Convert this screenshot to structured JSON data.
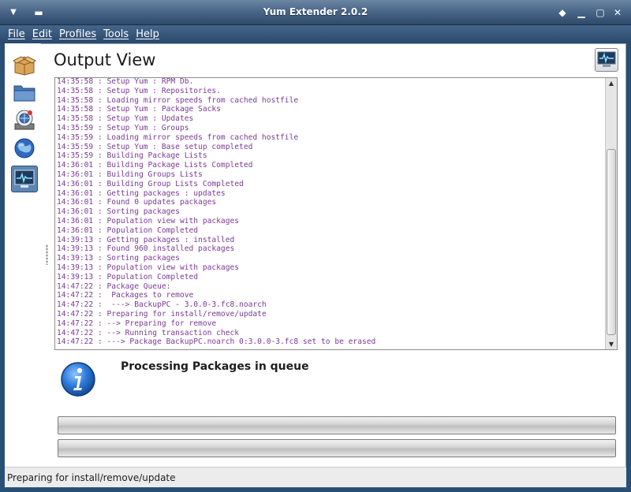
{
  "window": {
    "title": "Yum Extender 2.0.2"
  },
  "menu": [
    "File",
    "Edit",
    "Profiles",
    "Tools",
    "Help"
  ],
  "sidebar": {
    "items": [
      {
        "icon": "package-box-icon"
      },
      {
        "icon": "folder-icon"
      },
      {
        "icon": "repository-globe-icon"
      },
      {
        "icon": "globe-icon"
      },
      {
        "icon": "monitor-output-icon",
        "active": true
      }
    ]
  },
  "content": {
    "title": "Output View"
  },
  "log": {
    "lines": [
      "14:35:58 : Setup Yum : RPM Db.",
      "14:35:58 : Setup Yum : Repositories.",
      "14:35:58 : Loading mirror speeds from cached hostfile",
      "14:35:58 : Setup Yum : Package Sacks",
      "14:35:58 : Setup Yum : Updates",
      "14:35:59 : Setup Yum : Groups",
      "14:35:59 : Loading mirror speeds from cached hostfile",
      "14:35:59 : Setup Yum : Base setup completed",
      "14:35:59 : Building Package Lists",
      "14:36:01 : Building Package Lists Completed",
      "14:36:01 : Building Groups Lists",
      "14:36:01 : Building Group Lists Completed",
      "14:36:01 : Getting packages : updates",
      "14:36:01 : Found 0 updates packages",
      "14:36:01 : Sorting packages",
      "14:36:01 : Population view with packages",
      "14:36:01 : Population Completed",
      "14:39:13 : Getting packages : installed",
      "14:39:13 : Found 960 installed packages",
      "14:39:13 : Sorting packages",
      "14:39:13 : Population view with packages",
      "14:39:13 : Population Completed",
      "14:47:22 : Package Queue:",
      "14:47:22 :  Packages to remove",
      "14:47:22 :  ---> BackupPC - 3.0.0-3.fc8.noarch",
      "14:47:22 : Preparing for install/remove/update",
      "14:47:22 : --> Preparing for remove",
      "14:47:22 : --> Running transaction check",
      "14:47:22 : ---> Package BackupPC.noarch 0:3.0.0-3.fc8 set to be erased"
    ]
  },
  "info": {
    "message": "Processing Packages in queue",
    "icon": "info-icon"
  },
  "progress": [
    {
      "fraction": 0.0
    },
    {
      "fraction": 0.0
    }
  ],
  "status": {
    "text": "Preparing for install/remove/update"
  },
  "colors": {
    "log_text": "#7a3a96",
    "titlebar": "#4b6789",
    "active_sidebar": "#5d86b3"
  }
}
